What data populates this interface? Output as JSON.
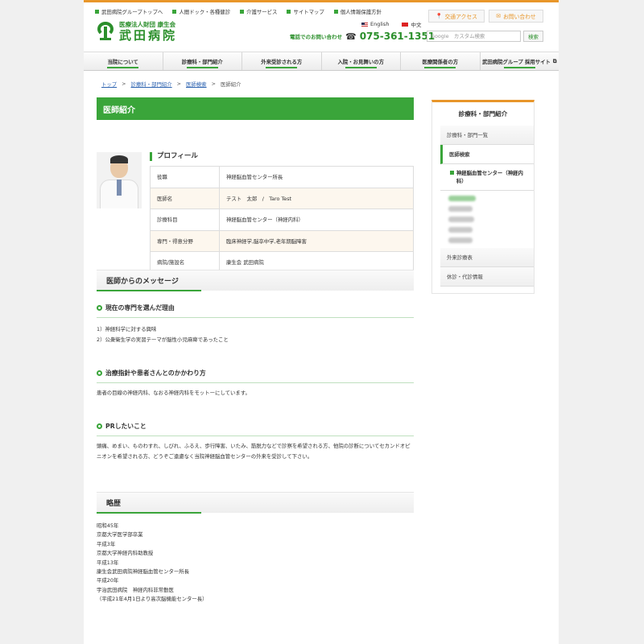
{
  "header": {
    "top_links": [
      "武田病院グループトップへ",
      "人間ドック・各種健診",
      "介護サービス",
      "サイトマップ",
      "個人情報保護方針"
    ],
    "logo_sub": "医療法人財団 康生会",
    "logo_main": "武田病院",
    "access_button": "交通アクセス",
    "contact_button": "お問い合わせ",
    "lang_en": "English",
    "lang_zh": "中文",
    "phone_label": "電話でのお問い合わせ",
    "phone_number": "075-361-1351",
    "search_placeholder": "Google　カスタム検索",
    "search_button": "検索"
  },
  "nav": [
    "当院について",
    "診療科・部門紹介",
    "外来受診される方",
    "入院・お見舞いの方",
    "医療関係者の方",
    "武田病院グループ 採用サイト"
  ],
  "breadcrumb": [
    "トップ",
    "診療科・部門紹介",
    "医師検索",
    "医師紹介"
  ],
  "page_title": "医師紹介",
  "profile": {
    "heading": "プロフィール",
    "rows": [
      {
        "label": "役職",
        "value": "神経脳血管センター所長"
      },
      {
        "label": "医師名",
        "value": "テスト　太郎　/　Taro Test"
      },
      {
        "label": "診療科目",
        "value": "神経脳血管センター（神経内科）"
      },
      {
        "label": "専門・得意分野",
        "value": "臨床神経学,脳卒中学,老年期脳障害"
      },
      {
        "label": "病院/施設名",
        "value": "康生会 武田病院"
      }
    ]
  },
  "message": {
    "heading": "医師からのメッセージ",
    "q1_title": "現在の専門を選んだ理由",
    "q1_lines": [
      "1）神経科学に対する興味",
      "2）公衆衛生学の実習テーマが脳性小児麻痺であったこと"
    ],
    "q2_title": "治療指針や患者さんとのかかわり方",
    "q2_text": "患者の目線の神経内科、なおる神経内科をモットーにしています。",
    "q3_title": "PRしたいこと",
    "q3_text": "頭痛、めまい、ものわすれ、しびれ、ふるえ、歩行障害、いたみ、筋脱力などで診察を希望される方、他院の診断についてセカンドオピニオンを希望される方、どうぞご遠慮なく当院神経脳血管センターの外来を受診して下さい。"
  },
  "history": {
    "heading": "略歴",
    "lines": [
      "昭和45年",
      "京都大学医学部卒業",
      "平成3年",
      "京都大学神経内科助教授",
      "平成13年",
      "康生会武田病院神経脳血管センター所長",
      "平成20年",
      "宇治武田病院　神経内科非常勤医",
      "（平成21年4月1日より高次脳機能センター長）"
    ]
  },
  "sidebar": {
    "title": "診療科・部門紹介",
    "items": [
      "診療科・部門一覧",
      "医師検索"
    ],
    "sub_item": "神経脳血管センター（神経内科）",
    "bottom_items": [
      "外来診療表",
      "休診・代診情報"
    ]
  },
  "colors": {
    "accent_green": "#3aa53a",
    "accent_orange": "#e8962a",
    "link_blue": "#2b62b0"
  }
}
